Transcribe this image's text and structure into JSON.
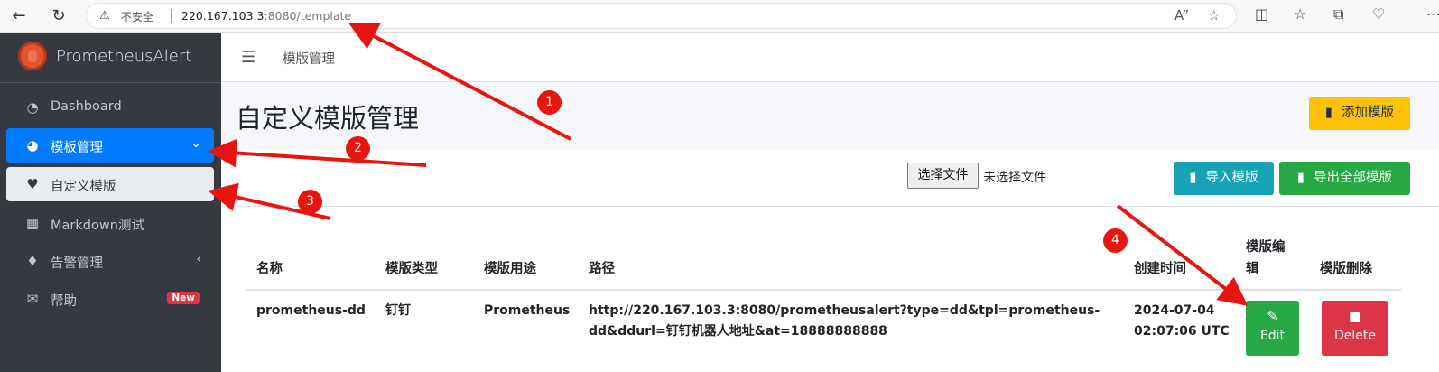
{
  "browser": {
    "warning_label": "不安全",
    "url_host": "220.167.103.3",
    "url_rest": ":8080/template"
  },
  "sidebar": {
    "brand": "PrometheusAlert",
    "items": [
      {
        "label": "Dashboard",
        "icon": "tachometer-icon"
      },
      {
        "label": "模板管理",
        "icon": "pie-chart-icon"
      },
      {
        "label": "自定义模版",
        "icon": "heart-icon"
      },
      {
        "label": "Markdown测试",
        "icon": "image-icon"
      },
      {
        "label": "告警管理",
        "icon": "bell-icon"
      },
      {
        "label": "帮助",
        "icon": "envelope-icon",
        "badge": "New"
      }
    ]
  },
  "topnav": {
    "breadcrumb": "模版管理"
  },
  "header": {
    "title": "自定义模版管理",
    "add_button": "添加模版"
  },
  "toolbar": {
    "file_button": "选择文件",
    "file_status": "未选择文件",
    "import_button": "导入模版",
    "export_button": "导出全部模版"
  },
  "table": {
    "columns": [
      "名称",
      "模版类型",
      "模版用途",
      "路径",
      "创建时间",
      "模版编",
      "辑",
      "模版删除"
    ],
    "rows": [
      {
        "name": "prometheus-dd",
        "type": "钉钉",
        "usage": "Prometheus",
        "path_line1": "http://220.167.103.3:8080/prometheusalert?type=dd&tpl=prometheus-",
        "path_line2": "dd&ddurl=钉钉机器人地址&at=18888888888",
        "created_line1": "2024-07-04",
        "created_line2": "02:07:06 UTC",
        "edit_label": "Edit",
        "delete_label": "Delete"
      }
    ]
  },
  "annotations": [
    "1",
    "2",
    "3",
    "4"
  ],
  "colors": {
    "sidebar_bg": "#343a40",
    "primary": "#007bff",
    "warning": "#ffc107",
    "info": "#17a2b8",
    "success": "#28a745",
    "danger": "#dc3545",
    "annotation": "#e8140f"
  }
}
